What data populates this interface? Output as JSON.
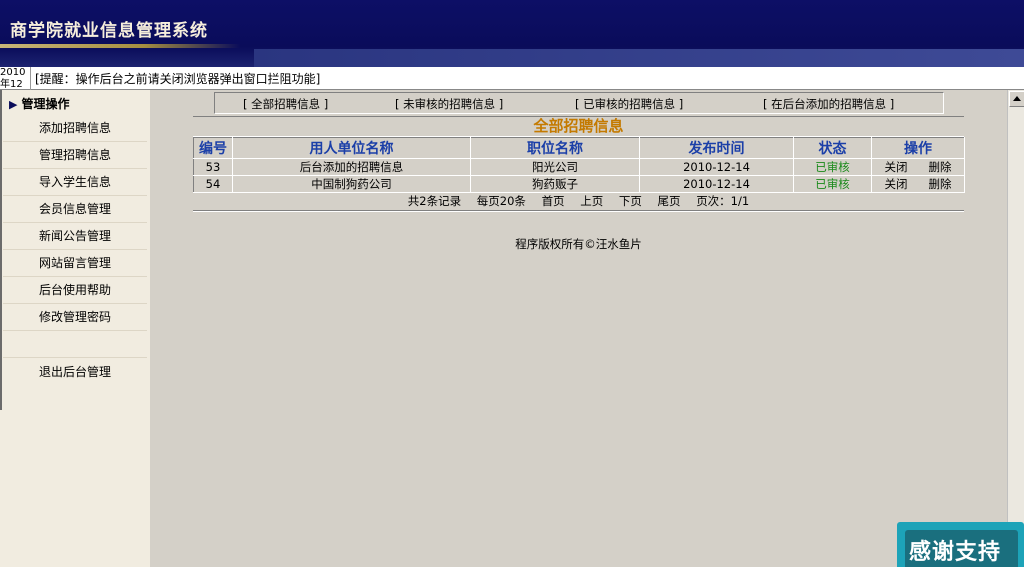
{
  "header": {
    "title": "商学院就业信息管理系统"
  },
  "notice": {
    "date": "2010年12",
    "text": "[提醒：操作后台之前请关闭浏览器弹出窗口拦阻功能]"
  },
  "sidebar": {
    "title": "管理操作",
    "items": [
      {
        "label": "添加招聘信息"
      },
      {
        "label": "管理招聘信息"
      },
      {
        "label": "导入学生信息"
      },
      {
        "label": "会员信息管理"
      },
      {
        "label": "新闻公告管理"
      },
      {
        "label": "网站留言管理"
      },
      {
        "label": "后台使用帮助"
      },
      {
        "label": "修改管理密码"
      },
      {
        "label": ""
      },
      {
        "label": "退出后台管理"
      }
    ]
  },
  "filters": [
    {
      "label": "[ 全部招聘信息 ]"
    },
    {
      "label": "[ 未审核的招聘信息 ]"
    },
    {
      "label": "[ 已审核的招聘信息 ]"
    },
    {
      "label": "[ 在后台添加的招聘信息 ]"
    }
  ],
  "panel": {
    "title": "全部招聘信息"
  },
  "table": {
    "headers": [
      "编号",
      "用人单位名称",
      "职位名称",
      "发布时间",
      "状态",
      "操作"
    ],
    "rows": [
      {
        "id": "53",
        "company": "后台添加的招聘信息",
        "position": "阳光公司",
        "date": "2010-12-14",
        "status": "已审核",
        "close": "关闭",
        "delete": "删除"
      },
      {
        "id": "54",
        "company": "中国制狗药公司",
        "position": "狗药贩子",
        "date": "2010-12-14",
        "status": "已审核",
        "close": "关闭",
        "delete": "删除"
      }
    ]
  },
  "pager": {
    "total": "共2条记录",
    "per_page": "每页20条",
    "first": "首页",
    "prev": "上页",
    "next": "下页",
    "last": "尾页",
    "page": "页次：1/1"
  },
  "footer": {
    "copyright": "程序版权所有©汪水鱼片"
  },
  "badge": {
    "text": "感谢支持"
  },
  "colors": {
    "header_bg": "#0d0f66",
    "panel_title": "#c47a00",
    "table_header": "#1b3fa8",
    "status_ok": "#1a8a1a",
    "badge": "#1da3b8"
  }
}
